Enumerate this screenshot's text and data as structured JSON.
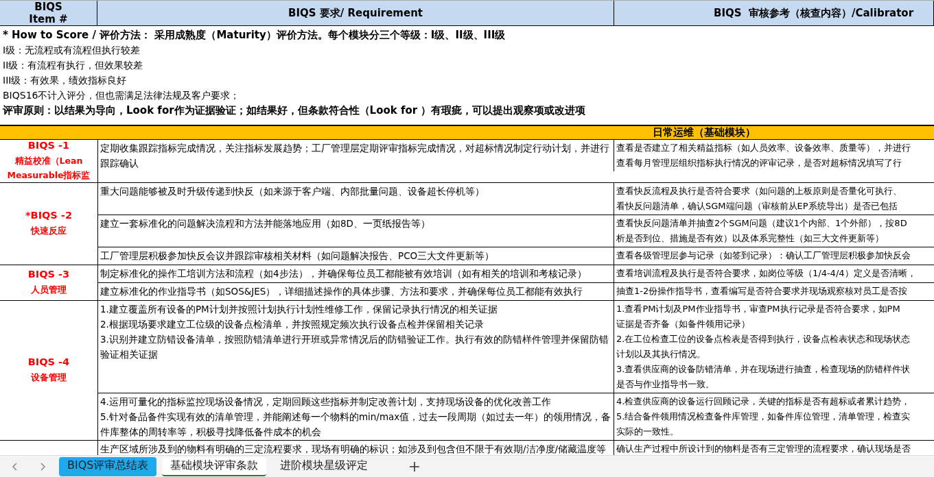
{
  "header": {
    "item": "BIQS\nItem #",
    "requirement": "BIQS 要求/ Requirement",
    "calibrator": "BIQS  审核参考（核查内容）/Calibrator"
  },
  "scoring": [
    {
      "text": "* How to Score / 评价方法： 采用成熟度（Maturity）评价方法。每个模块分三个等级：I级、II级、III级",
      "bold": true
    },
    {
      "text": "I级：无流程或有流程但执行较差",
      "bold": false
    },
    {
      "text": "II级：有流程有执行，但效果较差",
      "bold": false
    },
    {
      "text": "III级：有效果，绩效指标良好",
      "bold": false
    },
    {
      "text": "BIQS16不计入评分，但也需满足法律法规及客户要求；",
      "bold": false
    },
    {
      "text": "评审原则：以结果为导向，Look for作为证据验证；如结果好，但条款符合性（Look for ）有瑕疵，可以提出观察项或改进项",
      "bold": true
    }
  ],
  "section": "日常运维（基础模块）",
  "items": [
    {
      "code": "BIQS -1",
      "name": "精益校准（Lean\nMeasurable指标监",
      "rows": [
        {
          "requirement": "定期收集跟踪指标完成情况，关注指标发展趋势；工厂管理层定期评审指标完成情况，对超标情况制定行动计划，并进行跟踪确认",
          "calibrator": [
            "查看是否建立了相关精益指标（如人员效率、设备效率、质量等），并进行",
            "查看每月管理层组织指标执行情况的评审记录，是否对超标情况填写了行"
          ]
        }
      ]
    },
    {
      "code": "*BIQS -2",
      "name": "快速反应",
      "rows": [
        {
          "requirement": "重大问题能够被及时升级传递到快反（如来源于客户端、内部批量问题、设备超长停机等）",
          "calibrator": [
            "查看快反流程及执行是否符合要求（如问题的上板原则是否量化可执行、",
            "看快反问题清单，确认SGM端问题（审核前从EP系统导出）是否已包括"
          ]
        },
        {
          "requirement": "建立一套标准化的问题解决流程和方法并能落地应用（如8D、一页纸报告等）",
          "calibrator": [
            "查看快反问题清单并抽查2个SGM问题（建议1个内部、1个外部），按8D",
            "析是否到位、措施是否有效）以及体系完整性（如三大文件更新等）"
          ]
        },
        {
          "requirement": "工厂管理层积极参加快反会议并跟踪审核相关材料（如问题解决报告、PCO三大文件更新等）",
          "calibrator": [
            "查看各级管理层参与记录（如签到记录）：确认工厂管理层积极参加快反会"
          ]
        }
      ]
    },
    {
      "code": "BIQS -3",
      "name": "人员管理",
      "rows": [
        {
          "requirement": "制定标准化的操作工培训方法和流程（如4步法），并确保每位员工都能被有效培训（如有相关的培训和考核记录）",
          "calibrator": [
            "查看培训流程及执行是否符合要求，如岗位等级（1/4-4/4）定义是否清晰，"
          ]
        },
        {
          "requirement": "建立标准化的作业指导书（如SOS&JES），详细描述操作的具体步骤、方法和要求，并确保每位员工都能有效执行",
          "calibrator": [
            "抽查1-2份操作指导书，查看编写是否符合要求并现场观察核对员工是否按"
          ]
        }
      ]
    },
    {
      "code": "BIQS -4",
      "name": "设备管理",
      "rows": [
        {
          "requirement": "1.建立覆盖所有设备的PM计划并按照计划执行计划性维修工作，保留记录执行情况的相关证据\n2.根据现场要求建立工位级的设备点检清单，并按照规定频次执行设备点检并保留相关记录\n3.识别并建立防错设备清单，按照防错清单进行开班或异常情况后的防错验证工作。执行有效的防错样件管理并保留防错验证相关证据",
          "calibrator": [
            "1.查看PM计划及PM作业指导书，审查PM执行记录是否符合要求，如PM",
            "证据是否齐备（如备件领用记录）",
            "2.在工位检查工位的设备点检表是否得到执行，设备点检表状态和现场状态",
            "计划以及其执行情况。",
            "3.查看供应商的设备防错清单，并在现场进行抽查，检查现场的防错样件状",
            "是否与作业指导书一致。"
          ]
        },
        {
          "requirement": "4.运用可量化的指标监控现场设备情况，定期回顾这些指标并制定改善计划，支持现场设备的优化改善工作\n5.针对备品备件实现有效的清单管理，并能阐述每一个物料的min/max值，过去一段周期（如过去一年）的领用情况，备件库整体的周转率等，积极寻找降低备件成本的机会",
          "calibrator": [
            "4.检查供应商的设备运行回顾记录，关键的指标是否有超标或者累计趋势，",
            "5.结合备件领用情况检查备件库管理，如备件库位管理，清单管理，检查实",
            "实际的一致性。"
          ]
        }
      ]
    },
    {
      "rows": [
        {
          "requirement": "生产区域所涉及到的物料有明确的三定流程要求，现场有明确的标识；如涉及到包含但不限于有效期/洁净度/储藏温度等",
          "calibrator": [
            "确认生产过程中所设计到的物料是否有三定管理的流程要求，确认现场是否"
          ]
        }
      ]
    }
  ],
  "sheet_tabs": [
    {
      "label": "BIQS评审总结表",
      "selected": false,
      "color": "#1fa8ec"
    },
    {
      "label": "基础模块评审条款",
      "selected": true
    },
    {
      "label": "进阶模块星级评定",
      "selected": false
    }
  ]
}
